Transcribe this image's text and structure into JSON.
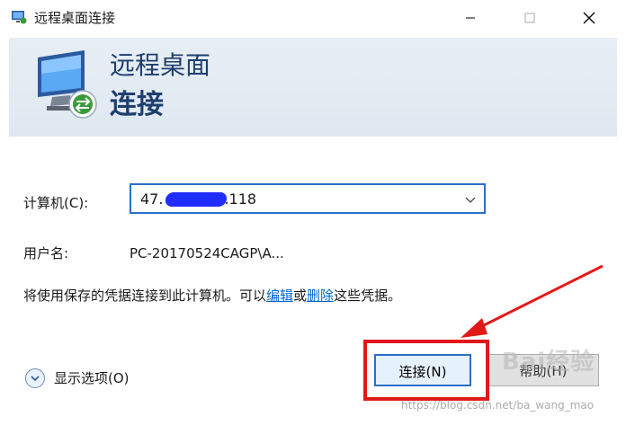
{
  "window": {
    "title": "远程桌面连接",
    "controls": {
      "minimize": "minimize-icon",
      "maximize": "maximize-icon",
      "close": "close-icon"
    }
  },
  "header": {
    "line1": "远程桌面",
    "line2": "连接"
  },
  "form": {
    "computer_label": "计算机(C):",
    "computer_value_prefix": "47.",
    "computer_value_suffix": ".118",
    "user_label": "用户名:",
    "user_value": "PC-20170524CAGP\\A..."
  },
  "note": {
    "prefix": "将使用保存的凭据连接到此计算机。可以",
    "edit_link": "编辑",
    "or_text": "或",
    "delete_link": "删除",
    "suffix": "这些凭据。"
  },
  "options_toggle": {
    "label": "显示选项(O)"
  },
  "buttons": {
    "connect": "连接(N)",
    "help": "帮助(H)"
  },
  "watermark": {
    "logo": "Bai经验",
    "url": "https://blog.csdn.net/ba_wang_mao"
  },
  "colors": {
    "accent": "#2a6fc9",
    "annotation_red": "#e11818",
    "header_text": "#1e3f6e",
    "link": "#0066cc"
  }
}
